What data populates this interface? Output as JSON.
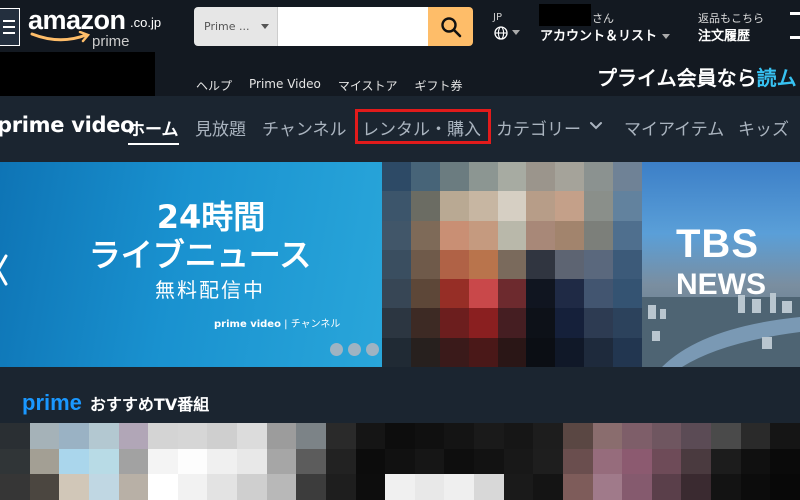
{
  "header": {
    "logo_word": "amazon",
    "logo_tld": ".co.jp",
    "logo_sub": "prime",
    "search": {
      "category": "Prime ...",
      "placeholder": ""
    },
    "language_code": "JP",
    "greeting_suffix": "さん",
    "account_label": "アカウント＆リスト",
    "returns_top": "返品もこちら",
    "returns_label": "注文履歴",
    "subnav": [
      "ヘルプ",
      "Prime Video",
      "マイストア",
      "ギフト券"
    ],
    "promo_text": "プライム会員なら",
    "promo_accent": "読ム"
  },
  "prime_nav": {
    "logo": "prime video",
    "items": [
      {
        "label": "ホーム",
        "active": true
      },
      {
        "label": "見放題",
        "active": false
      },
      {
        "label": "チャンネル",
        "active": false
      },
      {
        "label": "レンタル・購入",
        "active": false,
        "highlighted": true
      },
      {
        "label": "カテゴリー",
        "active": false
      },
      {
        "label": "マイアイテム",
        "active": false
      },
      {
        "label": "キッズ",
        "active": false
      }
    ]
  },
  "hero": {
    "line1": "24時間",
    "line2": "ライブニュース",
    "line3": "無料配信中",
    "brand_main": "prime video",
    "brand_sep": "|",
    "brand_sub": "チャンネル",
    "tbs_line1": "TBS",
    "tbs_line2": "NEWS",
    "dots_count": 3
  },
  "recommended": {
    "brand": "prime",
    "title": "おすすめTV番組"
  },
  "colors": {
    "header_bg": "#131921",
    "nav_bg": "#1b2530",
    "search_button": "#febd69",
    "highlight": "#e21b1b",
    "prime_blue": "#1a98ff",
    "promo_accent": "#37c2f2"
  }
}
